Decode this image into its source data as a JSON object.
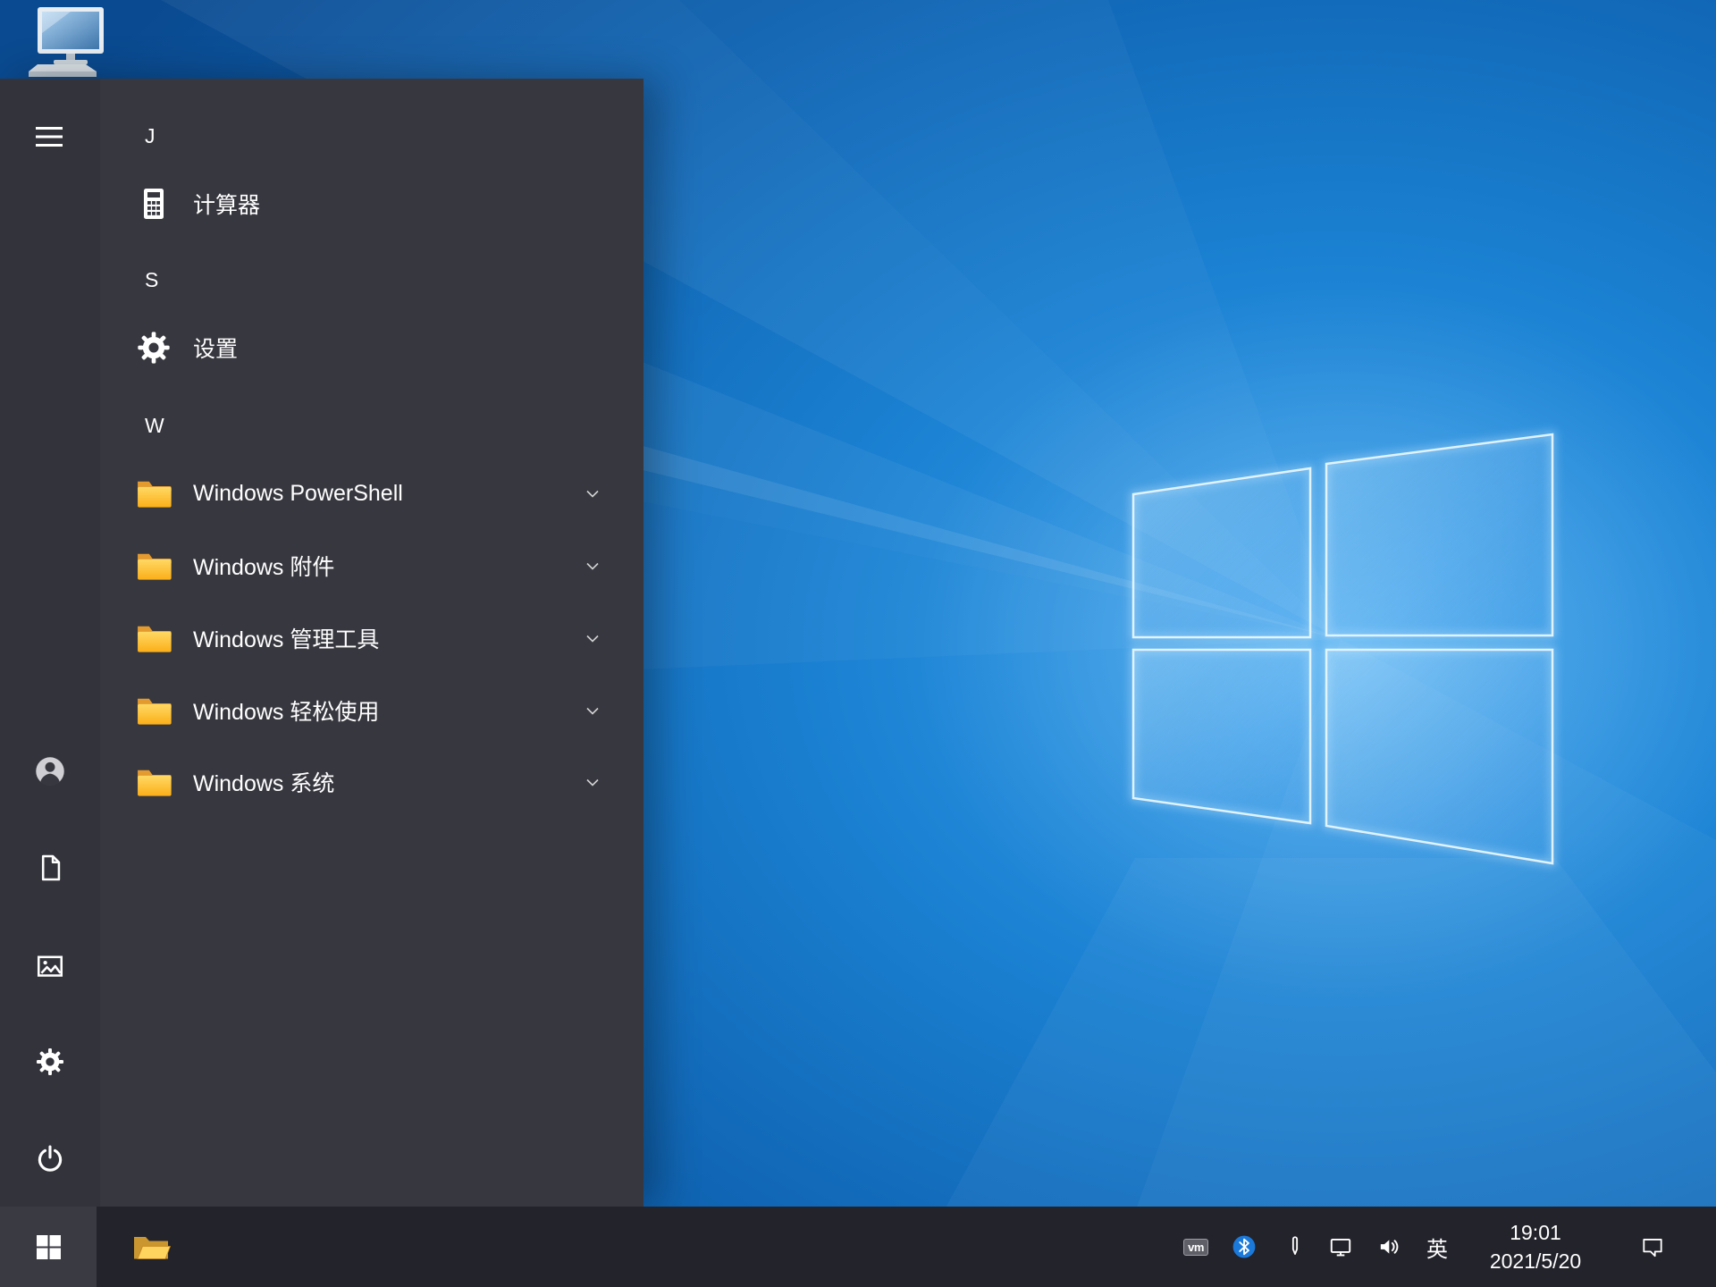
{
  "desktop": {
    "icons": [
      {
        "id": "this-pc",
        "icon": "computer-icon"
      }
    ]
  },
  "start_menu": {
    "rail": [
      {
        "id": "menu",
        "icon": "hamburger-icon"
      },
      {
        "id": "user",
        "icon": "user-icon"
      },
      {
        "id": "documents",
        "icon": "document-icon"
      },
      {
        "id": "pictures",
        "icon": "pictures-icon"
      },
      {
        "id": "settings",
        "icon": "gear-icon"
      },
      {
        "id": "power",
        "icon": "power-icon"
      }
    ],
    "sections": [
      {
        "header": "J",
        "items": [
          {
            "label": "计算器",
            "icon": "calculator-icon",
            "has_submenu": false
          }
        ]
      },
      {
        "header": "S",
        "items": [
          {
            "label": "设置",
            "icon": "gear-icon",
            "has_submenu": false
          }
        ]
      },
      {
        "header": "W",
        "items": [
          {
            "label": "Windows PowerShell",
            "icon": "folder-icon",
            "has_submenu": true
          },
          {
            "label": "Windows 附件",
            "icon": "folder-icon",
            "has_submenu": true
          },
          {
            "label": "Windows 管理工具",
            "icon": "folder-icon",
            "has_submenu": true
          },
          {
            "label": "Windows 轻松使用",
            "icon": "folder-icon",
            "has_submenu": true
          },
          {
            "label": "Windows 系统",
            "icon": "folder-icon",
            "has_submenu": true
          }
        ]
      }
    ]
  },
  "taskbar": {
    "start": {
      "icon": "windows-logo-icon"
    },
    "pinned": [
      {
        "id": "file-explorer",
        "icon": "folder-icon"
      }
    ],
    "tray": {
      "vm": "vm",
      "language": "英",
      "icons": [
        "vmware-icon",
        "bluetooth-icon",
        "pen-icon",
        "network-display-icon",
        "volume-icon",
        "action-center-icon"
      ]
    },
    "clock": {
      "time": "19:01",
      "date": "2021/5/20"
    }
  },
  "colors": {
    "menu_bg": "#37373f",
    "taskbar_bg": "#23232b",
    "wallpaper_blue": "#1273c4",
    "accent_blue": "#1b79da",
    "folder_yellow": "#ffd058",
    "text": "#ffffff"
  }
}
